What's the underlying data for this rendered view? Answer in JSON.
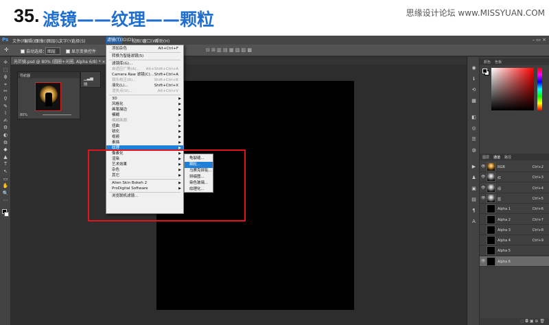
{
  "header": {
    "number": "35.",
    "title": "滤镜——纹理——颗粒",
    "watermark": "思缘设计论坛 www.MISSYUAN.COM"
  },
  "menubar": {
    "logo": "Ps",
    "items": [
      "文件(F)",
      "编辑(E)",
      "图像(I)",
      "图层(L)",
      "文字(Y)",
      "选择(S)",
      "滤镜(T)",
      "3D(D)",
      "视图(V)",
      "窗口(W)",
      "帮助(H)"
    ],
    "active_index": 6
  },
  "window_controls": "– ▭ ×",
  "options_bar": {
    "move_icon": "✛",
    "auto_select": "自动选择：",
    "layer_select": "图层",
    "show_transform": "显示变换控件"
  },
  "doc_tab": "光芒骑.psd @ 80% (圆圈+光圈, Alpha 6/8) * ×",
  "navigator": {
    "title": "导航器",
    "zoom": "80%"
  },
  "filter_menu": {
    "items": [
      {
        "label": "添加杂色",
        "shortcut": "Alt+Ctrl+F",
        "disabled": false,
        "arrow": false
      },
      {
        "sep": true
      },
      {
        "label": "转换为智能滤镜(S)",
        "shortcut": "",
        "disabled": false,
        "arrow": false
      },
      {
        "sep": true
      },
      {
        "label": "滤镜库(G)...",
        "shortcut": "",
        "disabled": false,
        "arrow": false
      },
      {
        "label": "自适应广角(A)...",
        "shortcut": "Alt+Shift+Ctrl+A",
        "disabled": true,
        "arrow": false
      },
      {
        "label": "Camera Raw 滤镜(C)...",
        "shortcut": "Shift+Ctrl+A",
        "disabled": false,
        "arrow": false
      },
      {
        "label": "镜头校正(R)...",
        "shortcut": "Shift+Ctrl+R",
        "disabled": true,
        "arrow": false
      },
      {
        "label": "液化(L)...",
        "shortcut": "Shift+Ctrl+X",
        "disabled": false,
        "arrow": false
      },
      {
        "label": "消失点(V)...",
        "shortcut": "Alt+Ctrl+V",
        "disabled": true,
        "arrow": false
      },
      {
        "sep": true
      },
      {
        "label": "3D",
        "shortcut": "",
        "disabled": false,
        "arrow": true
      },
      {
        "label": "风格化",
        "shortcut": "",
        "disabled": false,
        "arrow": true
      },
      {
        "label": "画笔描边",
        "shortcut": "",
        "disabled": false,
        "arrow": true
      },
      {
        "label": "模糊",
        "shortcut": "",
        "disabled": false,
        "arrow": true
      },
      {
        "label": "模糊画廊",
        "shortcut": "",
        "disabled": true,
        "arrow": true
      },
      {
        "label": "扭曲",
        "shortcut": "",
        "disabled": false,
        "arrow": true
      },
      {
        "label": "锐化",
        "shortcut": "",
        "disabled": false,
        "arrow": true
      },
      {
        "label": "视频",
        "shortcut": "",
        "disabled": false,
        "arrow": true
      },
      {
        "label": "素描",
        "shortcut": "",
        "disabled": false,
        "arrow": true
      },
      {
        "label": "纹理",
        "shortcut": "",
        "disabled": false,
        "arrow": true,
        "highlight": true
      },
      {
        "label": "像素化",
        "shortcut": "",
        "disabled": false,
        "arrow": true
      },
      {
        "label": "渲染",
        "shortcut": "",
        "disabled": false,
        "arrow": true
      },
      {
        "label": "艺术效果",
        "shortcut": "",
        "disabled": false,
        "arrow": true
      },
      {
        "label": "杂色",
        "shortcut": "",
        "disabled": false,
        "arrow": true
      },
      {
        "label": "其它",
        "shortcut": "",
        "disabled": false,
        "arrow": true
      },
      {
        "sep": true
      },
      {
        "label": "Alien Skin Bokeh 2",
        "shortcut": "",
        "disabled": false,
        "arrow": true
      },
      {
        "label": "ProDigital Software",
        "shortcut": "",
        "disabled": false,
        "arrow": true
      },
      {
        "sep": true
      },
      {
        "label": "浏览联机滤镜...",
        "shortcut": "",
        "disabled": false,
        "arrow": false
      }
    ]
  },
  "texture_submenu": {
    "items": [
      "龟裂缝...",
      "颗粒...",
      "马赛克拼贴...",
      "拼缀图...",
      "染色玻璃...",
      "纹理化..."
    ],
    "highlight_index": 1
  },
  "color_panel": {
    "tabs": [
      "颜色",
      "色板"
    ]
  },
  "channels_panel": {
    "tabs": [
      "图层",
      "通道",
      "路径"
    ],
    "rows": [
      {
        "name": "RGB",
        "shortcut": "Ctrl+2",
        "eye": true,
        "thumb": "col"
      },
      {
        "name": "红",
        "shortcut": "Ctrl+3",
        "eye": true,
        "thumb": "lit"
      },
      {
        "name": "绿",
        "shortcut": "Ctrl+4",
        "eye": true,
        "thumb": "lit"
      },
      {
        "name": "蓝",
        "shortcut": "Ctrl+5",
        "eye": true,
        "thumb": "lit"
      },
      {
        "name": "Alpha 1",
        "shortcut": "Ctrl+6",
        "eye": false,
        "thumb": "dark"
      },
      {
        "name": "Alpha 2",
        "shortcut": "Ctrl+7",
        "eye": false,
        "thumb": "dark"
      },
      {
        "name": "Alpha 3",
        "shortcut": "Ctrl+8",
        "eye": false,
        "thumb": "dark"
      },
      {
        "name": "Alpha 4",
        "shortcut": "Ctrl+9",
        "eye": false,
        "thumb": "dark"
      },
      {
        "name": "Alpha 5",
        "shortcut": "",
        "eye": false,
        "thumb": "dark"
      },
      {
        "name": "Alpha 6",
        "shortcut": "",
        "eye": true,
        "thumb": "dark",
        "selected": true
      }
    ]
  },
  "panel_footer_icons": "◌ ◘ ▣ ⊕ 🗑"
}
